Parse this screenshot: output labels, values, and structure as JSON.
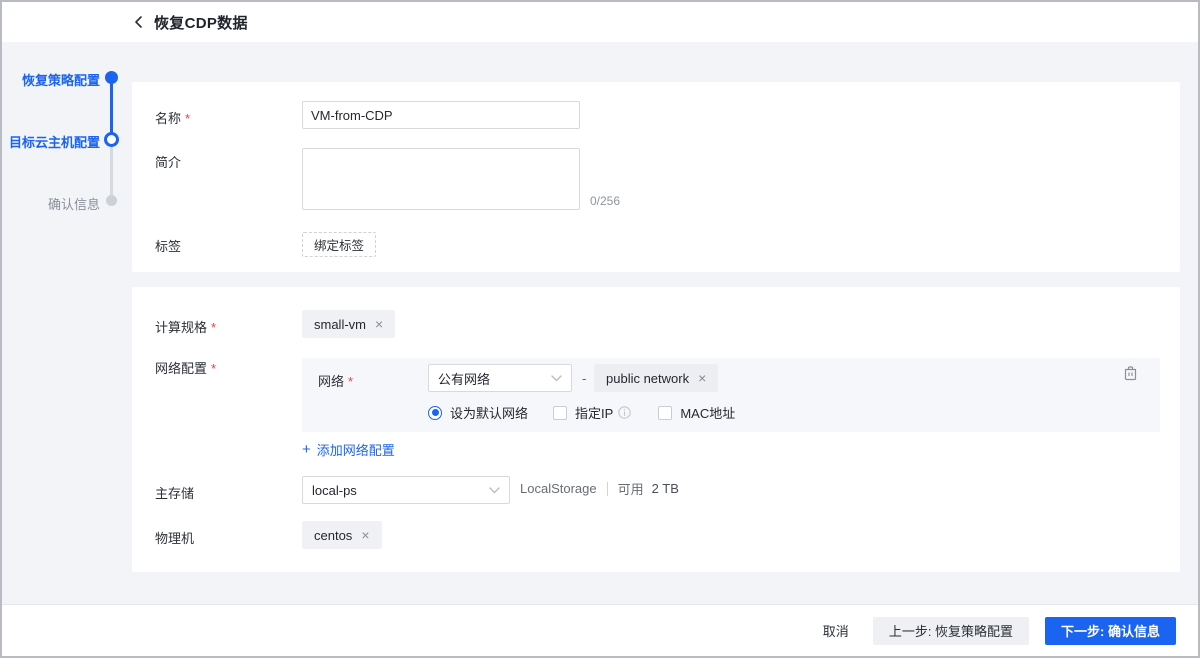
{
  "glyphs": {
    "close": "×",
    "plus": "+",
    "dash": "-"
  },
  "required_mark": "*",
  "header": {
    "title": "恢复CDP数据"
  },
  "steps": {
    "items": [
      {
        "label": "恢复策略配置",
        "state": "done"
      },
      {
        "label": "目标云主机配置",
        "state": "current"
      },
      {
        "label": "确认信息",
        "state": "pending"
      }
    ]
  },
  "basic": {
    "name_label": "名称",
    "name_value": "VM-from-CDP",
    "desc_label": "简介",
    "desc_value": "",
    "desc_counter": "0/256",
    "tag_label": "标签",
    "bind_tag_button": "绑定标签"
  },
  "config": {
    "spec_label": "计算规格",
    "spec_tag": "small-vm",
    "network_label": "网络配置",
    "network": {
      "net_label": "网络",
      "type_selected": "公有网络",
      "net_tag": "public network",
      "radio_default": "设为默认网络",
      "chk_ip": "指定IP",
      "chk_mac": "MAC地址"
    },
    "add_network": "添加网络配置",
    "storage_label": "主存储",
    "storage_selected": "local-ps",
    "storage_type": "LocalStorage",
    "storage_avail_label": "可用",
    "storage_avail_value": "2 TB",
    "host_label": "物理机",
    "host_tag": "centos"
  },
  "footer": {
    "cancel": "取消",
    "prev": "上一步: 恢复策略配置",
    "next": "下一步: 确认信息"
  },
  "colors": {
    "accent": "#1b64f2",
    "danger": "#f23c3c"
  }
}
